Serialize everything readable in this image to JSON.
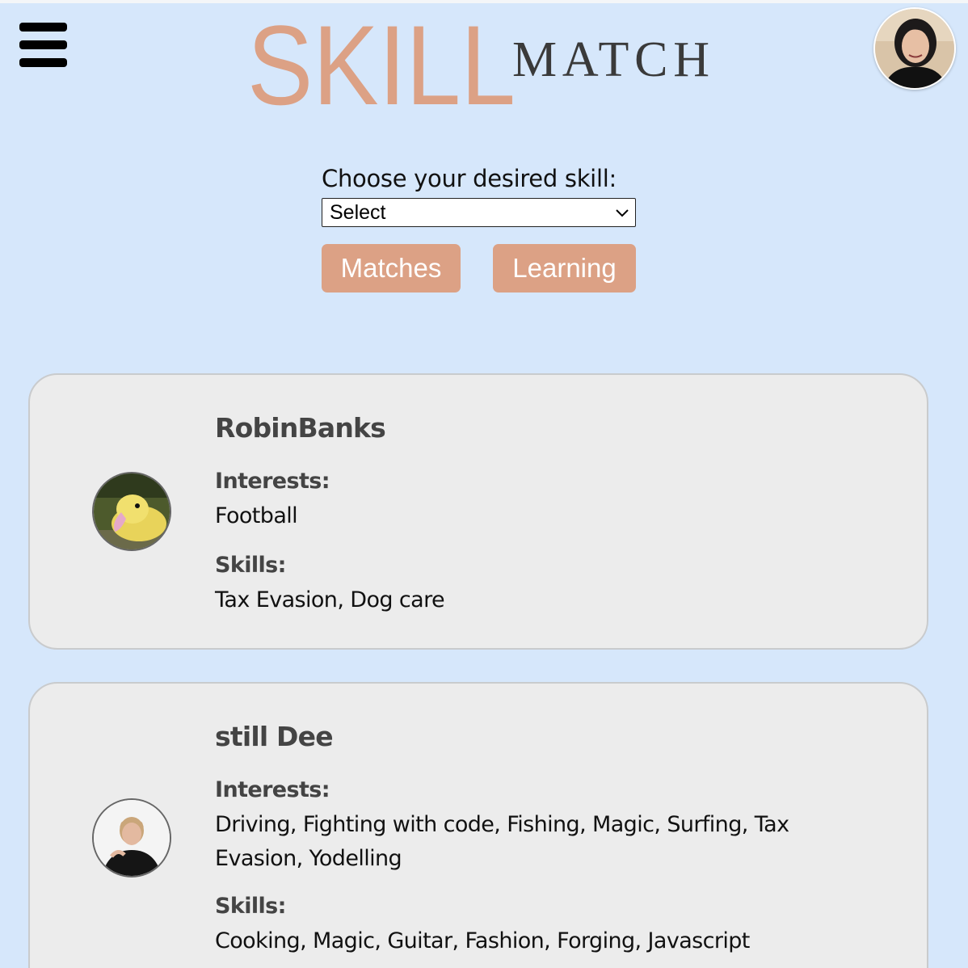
{
  "header": {
    "menu_icon": "hamburger-menu-icon",
    "logo": {
      "primary_text": "SKILL",
      "secondary_text": "MATCH",
      "primary_color": "#dca185",
      "secondary_color": "#3a3a3a"
    },
    "profile_avatar": "user-avatar"
  },
  "skill_chooser": {
    "label": "Choose your desired skill:",
    "selected_value": "Select"
  },
  "buttons": {
    "matches_label": "Matches",
    "learning_label": "Learning",
    "color": "#dca185"
  },
  "cards": [
    {
      "name": "RobinBanks",
      "avatar": "duckling-photo",
      "interests_heading": "Interests:",
      "interests": "Football",
      "skills_heading": "Skills:",
      "skills": "Tax Evasion, Dog care"
    },
    {
      "name": "still Dee",
      "avatar": "person-photo",
      "interests_heading": "Interests:",
      "interests": "Driving, Fighting with code, Fishing, Magic, Surfing, Tax Evasion, Yodelling",
      "skills_heading": "Skills:",
      "skills": "Cooking, Magic, Guitar, Fashion, Forging, Javascript"
    }
  ],
  "colors": {
    "background": "#d6e7fb",
    "card_background": "#ececec",
    "card_border": "#c9cbcd"
  }
}
